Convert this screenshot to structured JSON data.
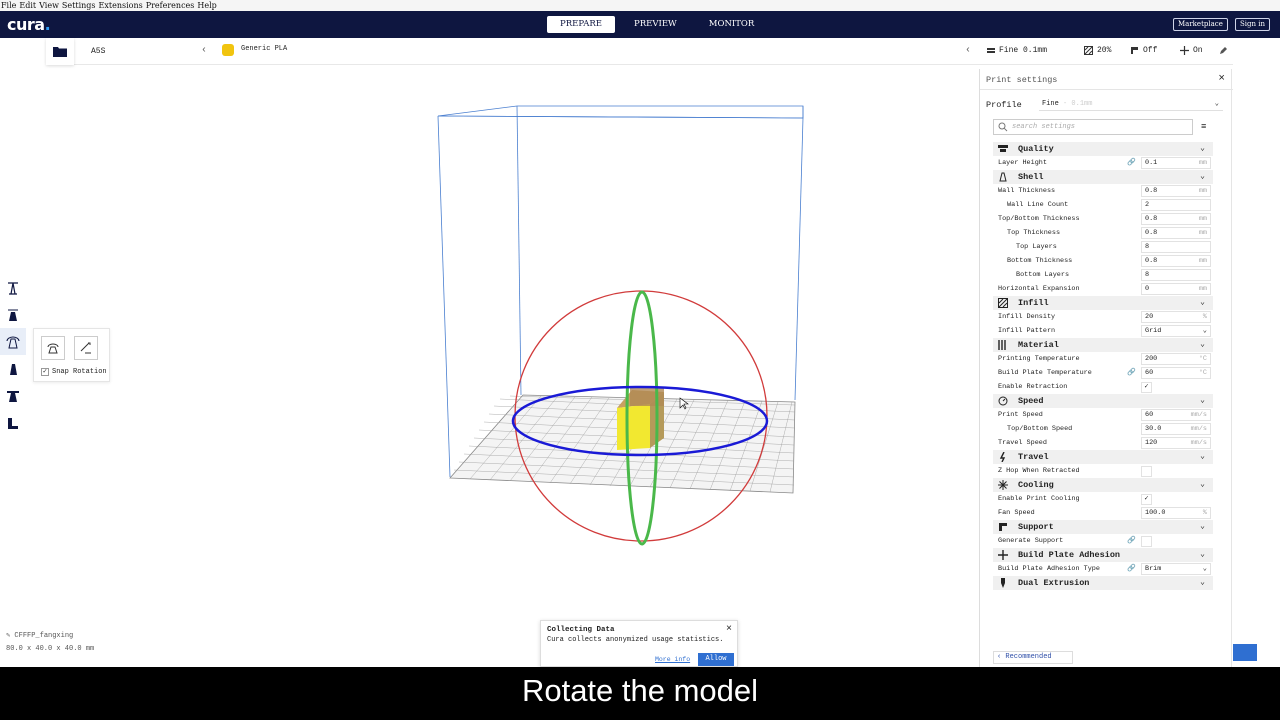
{
  "menu": [
    "File",
    "Edit",
    "View",
    "Settings",
    "Extensions",
    "Preferences",
    "Help"
  ],
  "brand": {
    "logo": "cura",
    "dot": "."
  },
  "stages": {
    "prepare": "PREPARE",
    "preview": "PREVIEW",
    "monitor": "MONITOR"
  },
  "header_buttons": {
    "marketplace": "Marketplace",
    "signin": "Sign in"
  },
  "toolbar": {
    "printer": "A5S",
    "material": "Generic PLA",
    "quality": "Fine 0.1mm",
    "infill": "20%",
    "support": "Off",
    "adhesion": "On"
  },
  "rotate_tool": {
    "snap_label": "Snap Rotation",
    "snap_checked": "✓"
  },
  "object": {
    "name": "CFFFP_fangxing",
    "dims": "80.0 x 40.0 x 40.0 mm"
  },
  "popup": {
    "title": "Collecting Data",
    "desc": "Cura collects anonymized usage statistics.",
    "more": "More info",
    "allow": "Allow",
    "close": "×"
  },
  "settings": {
    "title": "Print settings",
    "close": "×",
    "profile_label": "Profile",
    "profile_value": "Fine",
    "profile_sub": "- 0.1mm",
    "search_placeholder": "search settings",
    "recommended": "Recommended",
    "categories": {
      "quality": "Quality",
      "shell": "Shell",
      "infill": "Infill",
      "material": "Material",
      "speed": "Speed",
      "travel": "Travel",
      "cooling": "Cooling",
      "support": "Support",
      "adhesion": "Build Plate Adhesion",
      "dual": "Dual Extrusion"
    },
    "rows": {
      "layer_height": {
        "label": "Layer Height",
        "value": "0.1",
        "unit": "mm"
      },
      "wall_thickness": {
        "label": "Wall Thickness",
        "value": "0.8",
        "unit": "mm"
      },
      "wall_line_count": {
        "label": "Wall Line Count",
        "value": "2",
        "unit": ""
      },
      "top_bottom_thickness": {
        "label": "Top/Bottom Thickness",
        "value": "0.8",
        "unit": "mm"
      },
      "top_thickness": {
        "label": "Top Thickness",
        "value": "0.8",
        "unit": "mm"
      },
      "top_layers": {
        "label": "Top Layers",
        "value": "8",
        "unit": ""
      },
      "bottom_thickness": {
        "label": "Bottom Thickness",
        "value": "0.8",
        "unit": "mm"
      },
      "bottom_layers": {
        "label": "Bottom Layers",
        "value": "8",
        "unit": ""
      },
      "horizontal_expansion": {
        "label": "Horizontal Expansion",
        "value": "0",
        "unit": "mm"
      },
      "infill_density": {
        "label": "Infill Density",
        "value": "20",
        "unit": "%"
      },
      "infill_pattern": {
        "label": "Infill Pattern",
        "value": "Grid"
      },
      "printing_temperature": {
        "label": "Printing Temperature",
        "value": "200",
        "unit": "°C"
      },
      "build_plate_temperature": {
        "label": "Build Plate Temperature",
        "value": "60",
        "unit": "°C"
      },
      "enable_retraction": {
        "label": "Enable Retraction",
        "value": "✓"
      },
      "print_speed": {
        "label": "Print Speed",
        "value": "60",
        "unit": "mm/s"
      },
      "top_bottom_speed": {
        "label": "Top/Bottom Speed",
        "value": "30.0",
        "unit": "mm/s"
      },
      "travel_speed": {
        "label": "Travel Speed",
        "value": "120",
        "unit": "mm/s"
      },
      "z_hop": {
        "label": "Z Hop When Retracted",
        "value": ""
      },
      "enable_print_cooling": {
        "label": "Enable Print Cooling",
        "value": "✓"
      },
      "fan_speed": {
        "label": "Fan Speed",
        "value": "100.0",
        "unit": "%"
      },
      "generate_support": {
        "label": "Generate Support",
        "value": ""
      },
      "adhesion_type": {
        "label": "Build Plate Adhesion Type",
        "value": "Brim"
      }
    }
  },
  "caption": "Rotate the model",
  "colors": {
    "header": "#0e1640",
    "accent": "#2f6fd1",
    "rotate_x": "#d13b3b",
    "rotate_y": "#4ab84a",
    "rotate_z": "#1a1ad6",
    "model": "#f2e830"
  }
}
